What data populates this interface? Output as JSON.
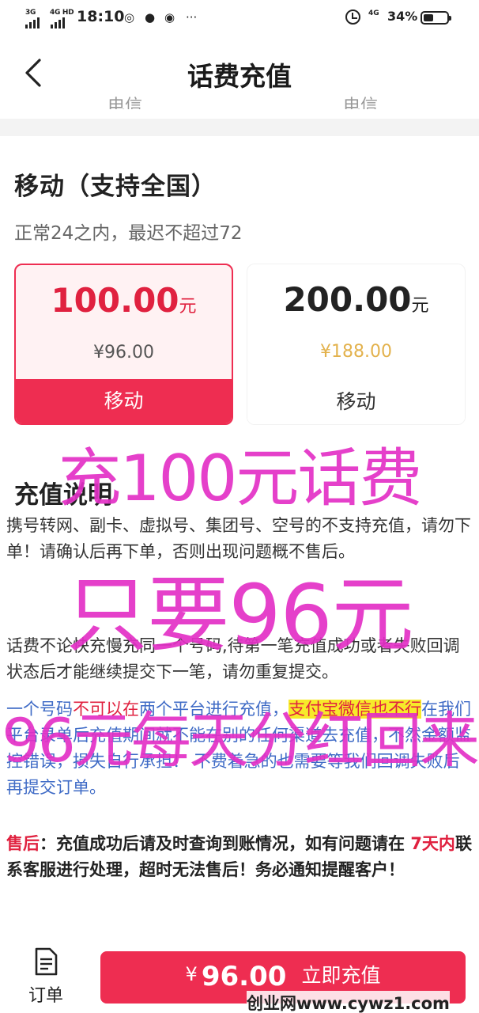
{
  "status_bar": {
    "sim1": "3G",
    "sim2": "4G HD",
    "time": "18:10",
    "net_small": "4G",
    "battery": "34%"
  },
  "nav": {
    "title": "话费充值",
    "peek_left": "电信",
    "peek_right": "电信"
  },
  "carrier": {
    "title": "移动（支持全国）",
    "subtitle": "正常24之内，最迟不超过72"
  },
  "cards": [
    {
      "amount": "100.00",
      "unit": "元",
      "price": "¥96.00",
      "label": "移动",
      "selected": true
    },
    {
      "amount": "200.00",
      "unit": "元",
      "price": "¥188.00",
      "label": "移动",
      "selected": false
    }
  ],
  "instructions": {
    "title": "充值说明",
    "p1": "携号转网、副卡、虚拟号、集团号、空号的不支持充值，请勿下单！请确认后再下单，否则出现问题概不售后。",
    "p2": "话费不论快充慢充同一个号码,待第一笔充值成功或者失败回调状态后才能继续提交下一笔，请勿重复提交。",
    "p3_a": "一个号码",
    "p3_b": "不可以在",
    "p3_c": "两个平台进行充值，",
    "p3_d": "支付宝微信也不行",
    "p3_e": "在我们平台录单后充值期间就不能在别的任何渠道去充值，不然金额监控错误，损失自行承担！ 不费着急的也需要等我们回调失败后再提交订单。",
    "p4_a": "售后",
    "p4_b": "：充值成功后请及时查询到账情况，如有问题请在 ",
    "p4_c": "7天内",
    "p4_d": "联系客服进行处理，超时无法售后！务必通知提醒客户！"
  },
  "promo": {
    "line1": "充100元话费",
    "line2": "只要96元",
    "line3": "96元每天分红回来"
  },
  "bottom": {
    "order_label": "订单",
    "currency": "¥",
    "amount": "96.00",
    "action": "立即充值"
  },
  "watermark": "创业网www.cywz1.com",
  "colors": {
    "accent": "#ee2d51",
    "promo": "#e330c6",
    "gold_price": "#e3b24d",
    "link_blue": "#3f6bc6",
    "highlight": "#f7ea2a"
  }
}
